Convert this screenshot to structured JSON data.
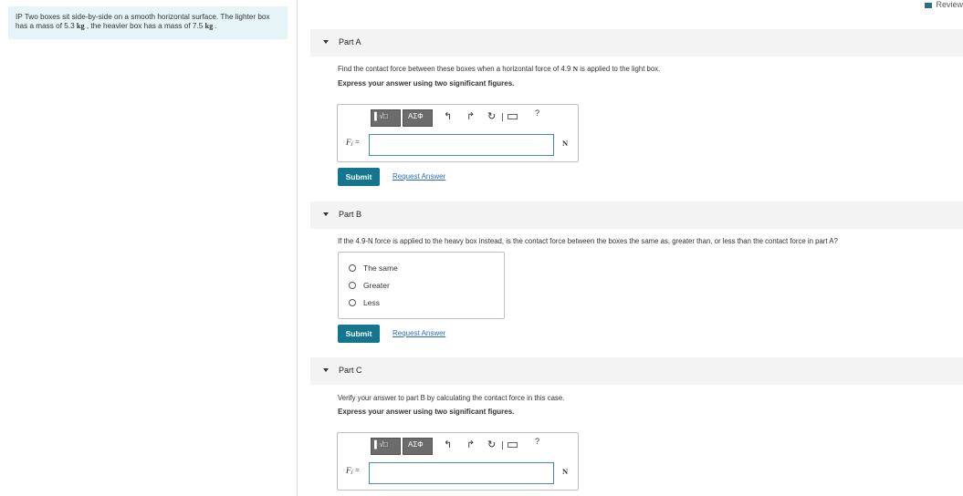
{
  "problem": {
    "label": "IP",
    "text1": "Two boxes sit side-by-side on a smooth horizontal surface. The lighter box has a mass of 5.3 ",
    "unit1": "kg",
    "text2": " , the heavier box has a mass of 7.5 ",
    "unit2": "kg",
    "text3": " ."
  },
  "review_label": "Review",
  "partA": {
    "title": "Part A",
    "question_pre": "Find the contact force between these boxes when a horizontal force of 4.9 ",
    "question_unit": "N",
    "question_post": " is applied to the light box.",
    "note": "Express your answer using two significant figures.",
    "var_label": "Fⱼ =",
    "unit": "N",
    "input_value": "",
    "submit_label": "Submit",
    "request_label": "Request Answer"
  },
  "partB": {
    "title": "Part B",
    "question": "If the 4.9-N force is applied to the heavy box instead, is the contact force between the boxes the same as, greater than, or less than the contact force in part A?",
    "choices": [
      "The same",
      "Greater",
      "Less"
    ],
    "submit_label": "Submit",
    "request_label": "Request Answer"
  },
  "partC": {
    "title": "Part C",
    "question": "Verify your answer to part B by calculating the contact force in this case.",
    "note": "Express your answer using two significant figures.",
    "var_label": "Fⱼ =",
    "unit": "N",
    "input_value": "",
    "submit_label": "Submit",
    "request_label": "Request Answer"
  },
  "toolbar": {
    "btn1_label": "▌√□",
    "btn2_label": "ΑΣΦ",
    "undo_icon": "↰",
    "redo_icon": "↱",
    "reset_icon": "↻",
    "help_label": "?"
  },
  "icons": {
    "undo": "undo-icon",
    "redo": "redo-icon",
    "reset": "reset-icon",
    "keyboard": "keyboard-icon",
    "review": "review-icon",
    "caret": "caret-down-icon"
  },
  "colors": {
    "accent": "#15758f",
    "problem_bg": "#e6f4f8",
    "header_bg": "#f3f3f3",
    "link": "#2a6fb5"
  }
}
